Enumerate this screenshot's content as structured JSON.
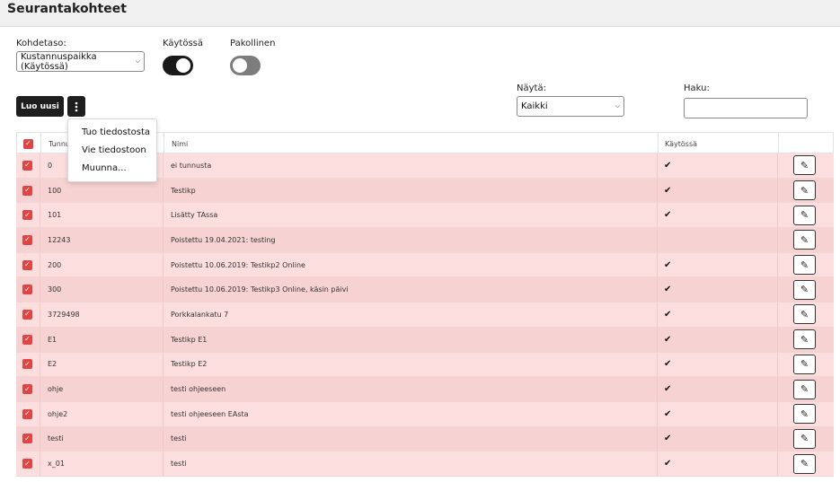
{
  "page": {
    "title": "Seurantakohteet"
  },
  "filters": {
    "kohdetaso_label": "Kohdetaso:",
    "kohdetaso_value": "Kustannuspaikka (Käytössä)",
    "kaytossa_label": "Käytössä",
    "kaytossa_on": true,
    "pakollinen_label": "Pakollinen",
    "pakollinen_on": false,
    "nayta_label": "Näytä:",
    "nayta_value": "Kaikki",
    "haku_label": "Haku:",
    "haku_value": ""
  },
  "toolbar": {
    "new_label": "Luo uusi",
    "more_icon": "kebab-vertical-icon"
  },
  "menu": {
    "items": [
      {
        "label": "Tuo tiedostosta"
      },
      {
        "label": "Vie tiedostoon"
      },
      {
        "label": "Muunna..."
      }
    ]
  },
  "table": {
    "headers": {
      "tunnus": "Tunnu",
      "nimi": "Nimi",
      "kaytossa": "Käytössä"
    },
    "check_icon": "checkmark-icon",
    "edit_icon": "pencil-icon",
    "rows": [
      {
        "tunnus": "0",
        "nimi": "ei tunnusta",
        "kaytossa": true
      },
      {
        "tunnus": "100",
        "nimi": "Testikp",
        "kaytossa": true
      },
      {
        "tunnus": "101",
        "nimi": "Lisätty TAssa",
        "kaytossa": true
      },
      {
        "tunnus": "12243",
        "nimi": "Poistettu 19.04.2021: testing",
        "kaytossa": false
      },
      {
        "tunnus": "200",
        "nimi": "Poistettu 10.06.2019: Testikp2 Online",
        "kaytossa": true
      },
      {
        "tunnus": "300",
        "nimi": "Poistettu 10.06.2019: Testikp3 Online, käsin päivi",
        "kaytossa": true
      },
      {
        "tunnus": "3729498",
        "nimi": "Porkkalankatu 7",
        "kaytossa": true
      },
      {
        "tunnus": "E1",
        "nimi": "Testikp E1",
        "kaytossa": true
      },
      {
        "tunnus": "E2",
        "nimi": "Testikp E2",
        "kaytossa": true
      },
      {
        "tunnus": "ohje",
        "nimi": "testi ohjeeseen",
        "kaytossa": true
      },
      {
        "tunnus": "ohje2",
        "nimi": "testi ohjeeseen EAsta",
        "kaytossa": true
      },
      {
        "tunnus": "testi",
        "nimi": "testi",
        "kaytossa": true
      },
      {
        "tunnus": "x_01",
        "nimi": "testi",
        "kaytossa": true
      }
    ]
  },
  "colors": {
    "row_highlight": "#fddede",
    "checkbox": "#e04545",
    "button_dark": "#1e1e1e"
  }
}
